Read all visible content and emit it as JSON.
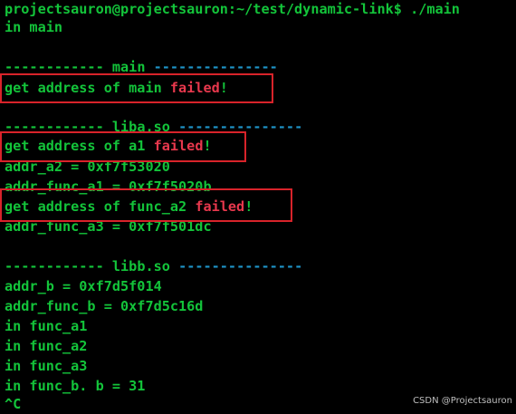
{
  "terminal": {
    "prompt": {
      "user_host": "projectsauron@projectsauron:~/test/dynamic-link$",
      "command": "./main"
    },
    "line_in_main": "in main",
    "section_main": {
      "dashes_left": "------------",
      "name": "main",
      "dashes_right": "---------------"
    },
    "main_error": {
      "text": "get address of main",
      "failed": "failed",
      "suffix": "!"
    },
    "section_liba": {
      "dashes_left": "------------",
      "name": "liba.so",
      "dashes_right": "---------------"
    },
    "liba_error_a1": {
      "text": "get address of a1",
      "failed": "failed",
      "suffix": "!"
    },
    "addr_a2": "addr_a2 = 0xf7f53020",
    "addr_func_a1": "addr_func_a1 = 0xf7f5020b",
    "liba_error_func_a2": {
      "text": "get address of func_a2",
      "failed": "failed",
      "suffix": "!"
    },
    "addr_func_a3": "addr_func_a3 = 0xf7f501dc",
    "section_libb": {
      "dashes_left": "------------",
      "name": "libb.so",
      "dashes_right": "---------------"
    },
    "addr_b": "addr_b = 0xf7d5f014",
    "addr_func_b": "addr_func_b = 0xf7d5c16d",
    "in_func_a1": "in func_a1",
    "in_func_a2": "in func_a2",
    "in_func_a3": "in func_a3",
    "in_func_b": "in func_b. b = 31",
    "interrupt": "^C"
  },
  "colors": {
    "background": "#000000",
    "text_green": "#13c43a",
    "separator_cyan": "#1e93c7",
    "failed_red": "#e8384d",
    "highlight_box": "#d8232a"
  },
  "watermark": "CSDN @Projectsauron"
}
